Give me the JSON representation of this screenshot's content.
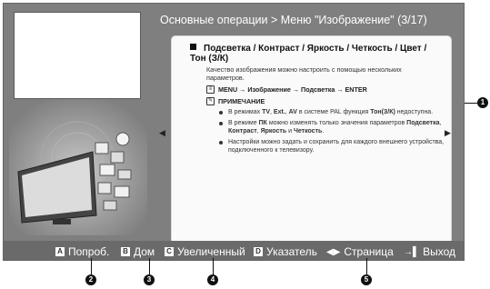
{
  "header": {
    "title": "Основные операции > Меню \"Изображение\" (3/17)"
  },
  "content": {
    "heading": "Подсветка / Контраст / Яркость / Четкость / Цвет / Тон (З/К)",
    "intro": "Качество изображения можно настроить с помощью нескольких параметров.",
    "menu_path": "MENU → Изображение → Подсветка → ENTER",
    "note_label": "ПРИМЕЧАНИЕ",
    "notes": [
      {
        "p1": "В режимах ",
        "b1": "TV",
        "p2": ", ",
        "b2": "Ext.",
        "p3": ", ",
        "b3": "AV",
        "p4": " в системе PAL функция ",
        "b4": "Тон(З/К)",
        "p5": " недоступна."
      },
      {
        "p1": "В режиме ",
        "b1": "ПК",
        "p2": " можно изменять только значения параметров ",
        "b2": "Подсветка",
        "p3": ", ",
        "b3": "Контраст",
        "p4": ", ",
        "b4": "Яркость",
        "p5": " и ",
        "b5": "Четкость",
        "p6": "."
      },
      {
        "text": "Настройки можно задать и сохранить для каждого внешнего устройства, подключенного к телевизору."
      }
    ]
  },
  "nav": {
    "left_arrow": "◀",
    "right_arrow": "▶"
  },
  "bottom_bar": {
    "a_key": "A",
    "a_label": "Попроб.",
    "b_key": "B",
    "b_label": "Дом",
    "c_key": "C",
    "c_label": "Увеличенный",
    "d_key": "D",
    "d_label": "Указатель",
    "page_symbol": "◀▶",
    "page_label": "Страница",
    "exit_symbol": "→▌",
    "exit_label": "Выход"
  },
  "callouts": [
    "1",
    "2",
    "3",
    "4",
    "5"
  ]
}
